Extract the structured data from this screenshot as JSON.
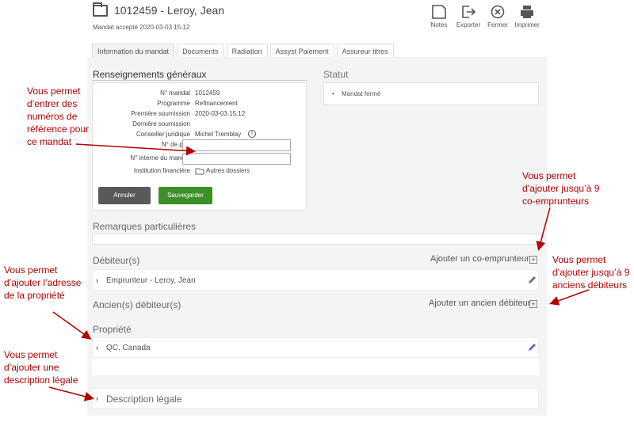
{
  "header": {
    "title": "1012459 - Leroy, Jean",
    "subtitle": "Mandat accepté 2020-03-03 15:12",
    "toolbar": {
      "notes": "Notes",
      "export": "Exporter",
      "close": "Fermer",
      "print": "Imprimer"
    }
  },
  "tabs": [
    "Information du mandat",
    "Documents",
    "Radiation",
    "Assyst Paiement",
    "Assureur titres"
  ],
  "general": {
    "title": "Renseignements généraux",
    "rows": {
      "mandate_no_label": "N° mandat",
      "mandate_no": "1012459",
      "program_label": "Programme",
      "program": "Refinancement",
      "first_sub_label": "Première soumission",
      "first_sub": "2020-03-03 15:12",
      "last_sub_label": "Dernière soumission",
      "legal_advisor_label": "Conseiller juridique",
      "legal_advisor": "Michel Tremblay",
      "loan_no_label": "N° de prêt",
      "internal_no_label": "N° interne du mandat",
      "institution_label": "Institution financière",
      "institution": "Autres dossiers"
    },
    "cancel": "Annuler",
    "save": "Sauvegarder"
  },
  "status": {
    "title": "Statut",
    "item": "Mandat fermé"
  },
  "remarks": {
    "title": "Remarques particulières"
  },
  "debtors": {
    "title": "Débiteur(s)",
    "add": "Ajouter un co-emprunteur",
    "item": "Emprunteur - Leroy, Jean"
  },
  "former_debtors": {
    "title": "Ancien(s) débiteur(s)",
    "add": "Ajouter un ancien débiteur"
  },
  "property": {
    "title": "Propriété",
    "item": "QC, Canada"
  },
  "legal_desc": {
    "title": "Description légale"
  },
  "annotations": {
    "ref_numbers": [
      "Vous permet",
      "d’entrer des",
      "numéros de",
      "référence pour",
      "ce mandat"
    ],
    "co_borrowers": [
      "Vous permet",
      "d’ajouter jusqu’à 9",
      "co-emprunteurs"
    ],
    "former_debtors": [
      "Vous permet",
      "d’ajouter jusqu’à 9",
      "anciens débiteurs"
    ],
    "address": [
      "Vous permet",
      "d’ajouter l’adresse",
      "de la propriété"
    ],
    "legal_desc": [
      "Vous permet",
      "d’ajouter une",
      "description légale"
    ]
  },
  "colors": {
    "annotation": "#b30000",
    "save": "#3d8f27",
    "cancel": "#595959"
  }
}
